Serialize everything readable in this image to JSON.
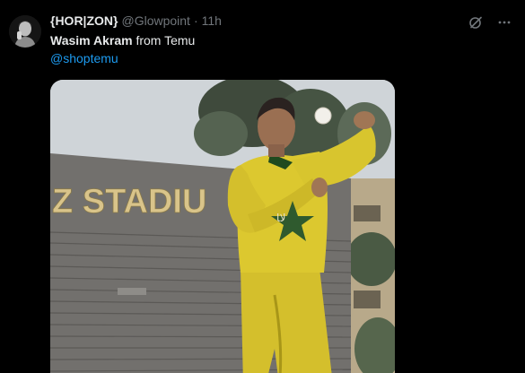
{
  "tweet": {
    "display_name": "{HOR|ZON}",
    "handle": "@Glowpoint",
    "separator": "·",
    "time": "11h",
    "text_bold": "Wasim Akram",
    "text_rest": " from Temu",
    "mention": "@shoptemu"
  },
  "media": {
    "sign_text": "Z STADIU",
    "jersey_text": "ﻻﺎ"
  },
  "icons": {
    "avatar": "avatar-image",
    "grok": "grok-icon",
    "more": "more-icon"
  },
  "colors": {
    "background": "#000000",
    "text": "#e7e9ea",
    "muted": "#71767b",
    "link": "#1d9bf0",
    "jersey_yellow": "#d7c32a",
    "jersey_green": "#2f5a2e"
  }
}
